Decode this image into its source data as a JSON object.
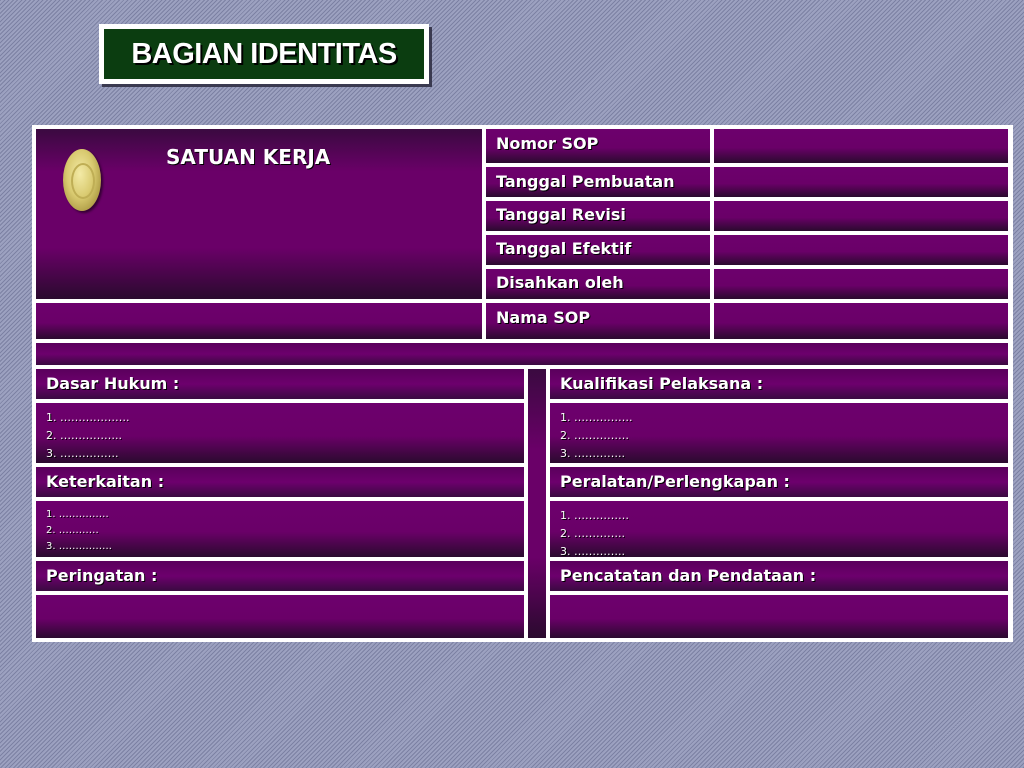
{
  "title": "BAGIAN IDENTITAS",
  "header": {
    "unit_label": "SATUAN KERJA",
    "fields": [
      {
        "label": "Nomor SOP",
        "value": ""
      },
      {
        "label": "Tanggal Pembuatan",
        "value": ""
      },
      {
        "label": "Tanggal Revisi",
        "value": ""
      },
      {
        "label": "Tanggal Efektif",
        "value": ""
      },
      {
        "label": "Disahkan oleh",
        "value": ""
      },
      {
        "label": "Nama SOP",
        "value": ""
      }
    ]
  },
  "left": {
    "dasar_hukum": {
      "label": "Dasar Hukum :",
      "items": [
        "1. ……………….",
        "2. ……………..",
        "3. ……………."
      ]
    },
    "keterkaitan": {
      "label": "Keterkaitan  :",
      "items": [
        "1. ……………",
        "2. …………",
        "3. ……………."
      ]
    },
    "peringatan": {
      "label": "Peringatan :",
      "body": ""
    }
  },
  "right": {
    "kualifikasi": {
      "label": "Kualifikasi Pelaksana :",
      "items": [
        "1. …………….",
        "2. ……………",
        "3. ………….."
      ]
    },
    "peralatan": {
      "label": "Peralatan/Perlengkapan :",
      "items": [
        "1. ……………",
        "2. …………..",
        "3. ………….."
      ]
    },
    "pencatatan": {
      "label": "Pencatatan dan Pendataan :",
      "body": ""
    }
  },
  "colors": {
    "cell": "#6a0068",
    "title_bg": "#0b3d10",
    "border": "#ffffff"
  },
  "icons": {
    "logo": "coin-emblem-icon"
  }
}
